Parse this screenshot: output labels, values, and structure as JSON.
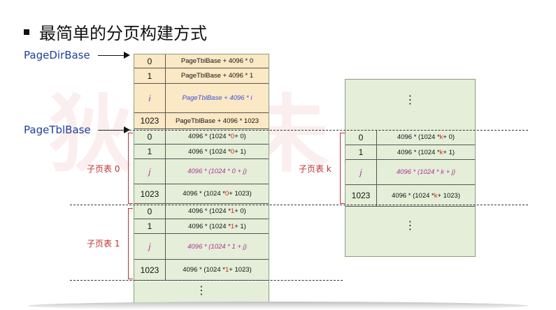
{
  "watermark": "狄泰未来",
  "title": "最简单的分页构建方式",
  "labels": {
    "page_dir_base": "PageDirBase",
    "page_tbl_base": "PageTblBase"
  },
  "page_dir": [
    {
      "idx": "0",
      "parts": [
        [
          "PageTblBase  + 4096 * 0",
          ""
        ]
      ]
    },
    {
      "idx": "1",
      "parts": [
        [
          "PageTblBase  + 4096 * 1",
          ""
        ]
      ]
    },
    {
      "idx": "i",
      "parts": [
        [
          "PageTblBase  + 4096 * i",
          ""
        ]
      ],
      "style": "blue-italic"
    },
    {
      "idx": "1023",
      "parts": [
        [
          "PageTblBase  + 4096 * 1023",
          ""
        ]
      ]
    }
  ],
  "sub_table_0": {
    "label": "子页表 0",
    "rows": [
      {
        "idx": "0",
        "parts": [
          [
            "4096 * (1024 * ",
            ""
          ],
          [
            "0",
            "red"
          ],
          [
            " + 0)",
            ""
          ]
        ]
      },
      {
        "idx": "1",
        "parts": [
          [
            "4096 * (1024 * ",
            ""
          ],
          [
            "0",
            "red"
          ],
          [
            " + 1)",
            ""
          ]
        ]
      },
      {
        "idx": "j",
        "parts": [
          [
            "4096 * (1024 * 0 + j)",
            ""
          ]
        ],
        "style": "magenta-italic"
      },
      {
        "idx": "1023",
        "parts": [
          [
            "4096 * (1024 * ",
            ""
          ],
          [
            "0",
            "red"
          ],
          [
            " + 1023)",
            ""
          ]
        ]
      }
    ]
  },
  "sub_table_1": {
    "label": "子页表 1",
    "rows": [
      {
        "idx": "0",
        "parts": [
          [
            "4096 * (1024 * ",
            ""
          ],
          [
            "1",
            "red"
          ],
          [
            " + 0)",
            ""
          ]
        ]
      },
      {
        "idx": "1",
        "parts": [
          [
            "4096 * (1024 * ",
            ""
          ],
          [
            "1",
            "red"
          ],
          [
            " + 1)",
            ""
          ]
        ]
      },
      {
        "idx": "j",
        "parts": [
          [
            "4096 * (1024 * 1 + j)",
            ""
          ]
        ],
        "style": "magenta-italic"
      },
      {
        "idx": "1023",
        "parts": [
          [
            "4096 * (1024 * ",
            ""
          ],
          [
            "1",
            "red"
          ],
          [
            " + 1023)",
            ""
          ]
        ]
      }
    ]
  },
  "sub_table_k": {
    "label": "子页表 k",
    "rows": [
      {
        "idx": "0",
        "parts": [
          [
            "4096 * (1024 * ",
            ""
          ],
          [
            "k",
            "red"
          ],
          [
            " + 0)",
            ""
          ]
        ]
      },
      {
        "idx": "1",
        "parts": [
          [
            "4096 * (1024 * ",
            ""
          ],
          [
            "k",
            "red"
          ],
          [
            " + 1)",
            ""
          ]
        ]
      },
      {
        "idx": "j",
        "parts": [
          [
            "4096 * (1024 * k + j)",
            ""
          ]
        ],
        "style": "magenta-italic"
      },
      {
        "idx": "1023",
        "parts": [
          [
            "4096 * (1024 * ",
            ""
          ],
          [
            "k",
            "red"
          ],
          [
            " + 1023)",
            ""
          ]
        ]
      }
    ]
  },
  "ellipsis": "⋮",
  "colors": {
    "dir_fill": "#fbe8c4",
    "table_fill": "#e4eed8",
    "label_blue": "#1f3ea0",
    "accent_red": "#e02020",
    "italic_blue": "#3a4fd6",
    "italic_magenta": "#b0309a"
  }
}
